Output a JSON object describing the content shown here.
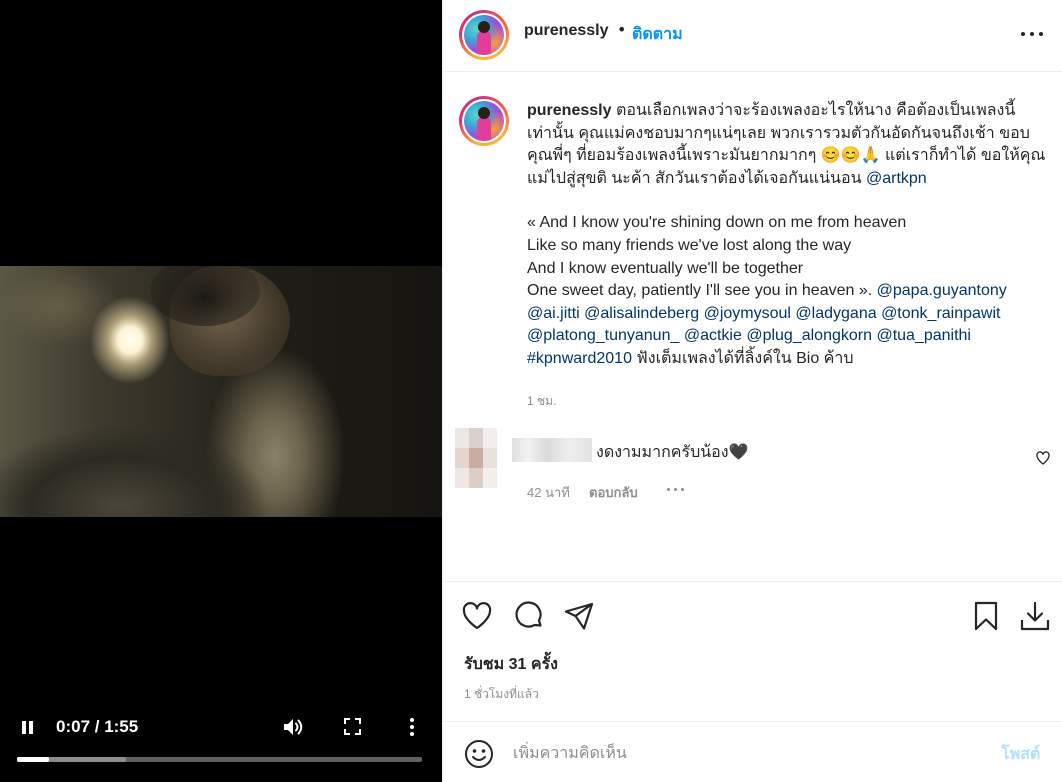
{
  "video": {
    "current_time": "0:07",
    "duration": "1:55",
    "time_display": "0:07 / 1:55",
    "progress_fraction": 0.08,
    "buffered_fraction": 0.27
  },
  "post": {
    "username": "purenessly",
    "separator": "•",
    "follow_label": "ติดตาม",
    "caption": {
      "username": "purenessly",
      "lines": [
        "ตอนเลือกเพลงว่าจะร้องเพลงอะไรให้นาง คือต้องเป็นเพลงนี้",
        "เท่านั้น คุณแม่คงชอบมากๆแน่ๆเลย พวกเรารวมตัวกันอัดกันจนถึงเช้า ขอบ",
        "คุณพี่ๆ ที่ยอมร้องเพลงนี้เพราะมันยากมากๆ 😊😊🙏 แต่เราก็ทำได้ ขอให้คุณ",
        "แม่ไปสู่สุขติ นะค้า สักวันเราต้องได้เจอกันแน่นอน"
      ],
      "mention_artkpn": "@artkpn",
      "lyrics": [
        "« And I know you're shining down on me from heaven",
        "Like so many friends we've lost along the way",
        "And I know eventually we'll be together",
        "One sweet day, patiently I'll see you in heaven »."
      ],
      "mentions": [
        "@papa.guyantony",
        "@ai.jitti",
        "@alisalindeberg",
        "@joymysoul",
        "@ladygana",
        "@tonk_rainpawit",
        "@platong_tunyanun_",
        "@actkie",
        "@plug_alongkorn",
        "@tua_panithi"
      ],
      "hashtag": "#kpnward2010",
      "tail_text": "ฟังเต็มเพลงได้ที่ลิ้งค์ใน Bio ค้าบ",
      "time": "1 ชม."
    }
  },
  "comment": {
    "text": "งดงามมากครับน้อง🖤",
    "time": "42 นาที",
    "reply_label": "ตอบกลับ"
  },
  "actions": {
    "views": "รับชม 31 ครั้ง",
    "posted_ago": "1 ชั่วโมงที่แล้ว"
  },
  "add_comment": {
    "placeholder": "เพิ่มความคิดเห็น",
    "post_label": "โพสต์"
  },
  "colors": {
    "accent": "#0095f6",
    "mention": "#00376b",
    "muted": "#8e8e8e",
    "post_disabled": "#b2dffc"
  },
  "icons": [
    "pause-icon",
    "volume-icon",
    "fullscreen-icon",
    "more-vertical-icon",
    "more-horizontal-icon",
    "heart-icon",
    "comment-icon",
    "share-icon",
    "bookmark-icon",
    "download-icon",
    "emoji-icon"
  ]
}
